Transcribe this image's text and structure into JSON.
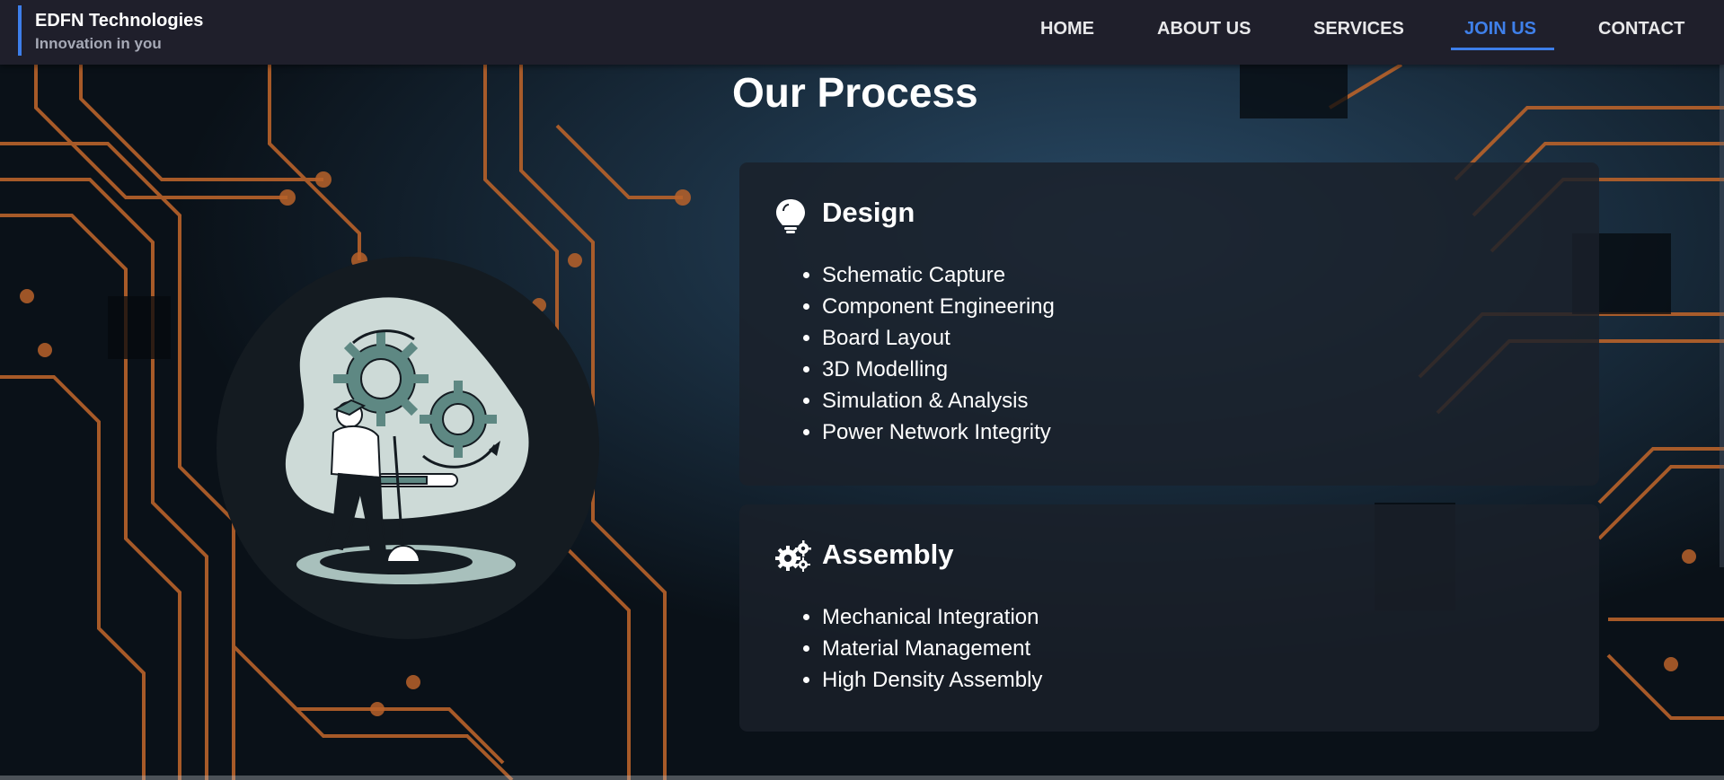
{
  "brand": {
    "name": "EDFN Technologies",
    "tagline": "Innovation in you"
  },
  "nav": {
    "items": [
      {
        "label": "HOME"
      },
      {
        "label": "ABOUT US"
      },
      {
        "label": "SERVICES"
      },
      {
        "label": "JOIN US"
      },
      {
        "label": "CONTACT"
      }
    ],
    "active": "JOIN US"
  },
  "page": {
    "title": "Our Process"
  },
  "cards": [
    {
      "icon": "lightbulb-icon",
      "title": "Design",
      "items": [
        "Schematic Capture",
        "Component Engineering",
        "Board Layout",
        "3D Modelling",
        "Simulation & Analysis",
        "Power Network Integrity"
      ]
    },
    {
      "icon": "gears-icon",
      "title": "Assembly",
      "items": [
        "Mechanical Integration",
        "Material Management",
        "High Density Assembly"
      ]
    }
  ],
  "illustration": {
    "icon": "engineer-with-gears-illustration"
  },
  "colors": {
    "accent": "#3d7eea",
    "navbar": "#1f1f2b",
    "card": "#1a202a",
    "circuit_trace": "#b8622a",
    "illustration_teal": "#5e8883",
    "illustration_blob": "#cddad7"
  }
}
